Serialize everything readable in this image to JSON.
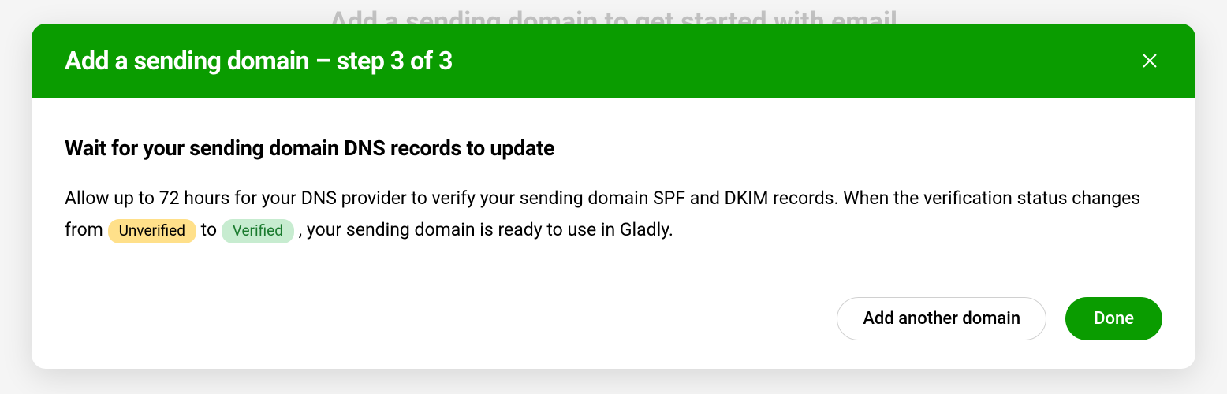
{
  "background": {
    "text": "Add a sending domain to get started with email"
  },
  "modal": {
    "title": "Add a sending domain – step 3 of 3",
    "body": {
      "heading": "Wait for your sending domain DNS records to update",
      "text_before_badge1": "Allow up to 72 hours for your DNS provider to verify your sending domain SPF and DKIM records. When the verification status changes from ",
      "badge_unverified": "Unverified",
      "text_between": " to ",
      "badge_verified": "Verified",
      "text_after": ", your sending domain is ready to use in Gladly."
    },
    "footer": {
      "secondary_button": "Add another domain",
      "primary_button": "Done"
    }
  }
}
